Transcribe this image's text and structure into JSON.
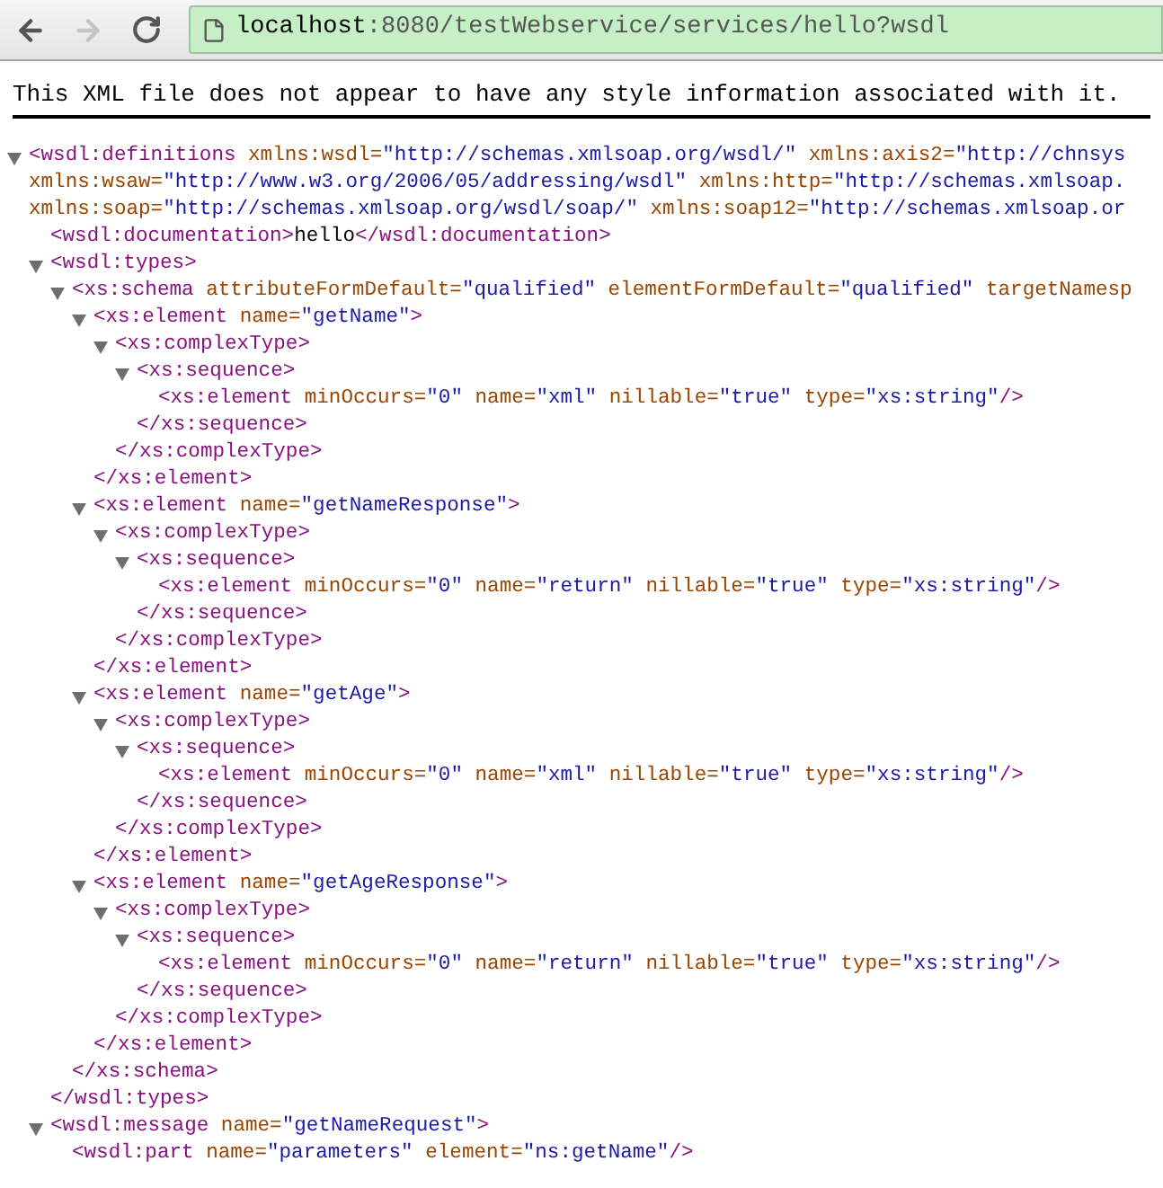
{
  "toolbar": {
    "back": {
      "disabled": false
    },
    "forward": {
      "disabled": true
    },
    "address": {
      "host": "localhost",
      "path": ":8080/testWebservice/services/hello?wsdl"
    }
  },
  "notice": "This XML file does not appear to have any style information associated with it.",
  "tree": [
    {
      "expanded": true,
      "lines": [
        [
          {
            "kind": "tag",
            "text": "<wsdl:definitions"
          },
          {
            "kind": "attr",
            "text": " xmlns:wsdl="
          },
          {
            "kind": "value",
            "text": "\"http://schemas.xmlsoap.org/wsdl/\""
          },
          {
            "kind": "attr",
            "text": " xmlns:axis2="
          },
          {
            "kind": "value",
            "text": "\"http://chnsys"
          }
        ],
        [
          {
            "kind": "attr",
            "text": "xmlns:wsaw="
          },
          {
            "kind": "value",
            "text": "\"http://www.w3.org/2006/05/addressing/wsdl\""
          },
          {
            "kind": "attr",
            "text": " xmlns:http="
          },
          {
            "kind": "value",
            "text": "\"http://schemas.xmlsoap."
          }
        ],
        [
          {
            "kind": "attr",
            "text": "xmlns:soap="
          },
          {
            "kind": "value",
            "text": "\"http://schemas.xmlsoap.org/wsdl/soap/\""
          },
          {
            "kind": "attr",
            "text": " xmlns:soap12="
          },
          {
            "kind": "value",
            "text": "\"http://schemas.xmlsoap.or"
          }
        ]
      ],
      "children": [
        {
          "lines": [
            [
              {
                "kind": "tag",
                "text": "<wsdl:documentation>"
              },
              {
                "kind": "text",
                "text": "hello"
              },
              {
                "kind": "tag",
                "text": "</wsdl:documentation>"
              }
            ]
          ]
        },
        {
          "expanded": true,
          "lines": [
            [
              {
                "kind": "tag",
                "text": "<wsdl:types>"
              }
            ]
          ],
          "close": "</wsdl:types>",
          "children": [
            {
              "expanded": true,
              "lines": [
                [
                  {
                    "kind": "tag",
                    "text": "<xs:schema"
                  },
                  {
                    "kind": "attr",
                    "text": " attributeFormDefault="
                  },
                  {
                    "kind": "value",
                    "text": "\"qualified\""
                  },
                  {
                    "kind": "attr",
                    "text": " elementFormDefault="
                  },
                  {
                    "kind": "value",
                    "text": "\"qualified\""
                  },
                  {
                    "kind": "attr",
                    "text": " targetNamesp"
                  }
                ]
              ],
              "close": "</xs:schema>",
              "children": [
                {
                  "expanded": true,
                  "lines": [
                    [
                      {
                        "kind": "tag",
                        "text": "<xs:element"
                      },
                      {
                        "kind": "attr",
                        "text": " name="
                      },
                      {
                        "kind": "value",
                        "text": "\"getName\""
                      },
                      {
                        "kind": "tag",
                        "text": ">"
                      }
                    ]
                  ],
                  "close": "</xs:element>",
                  "children": [
                    {
                      "expanded": true,
                      "lines": [
                        [
                          {
                            "kind": "tag",
                            "text": "<xs:complexType>"
                          }
                        ]
                      ],
                      "close": "</xs:complexType>",
                      "children": [
                        {
                          "expanded": true,
                          "lines": [
                            [
                              {
                                "kind": "tag",
                                "text": "<xs:sequence>"
                              }
                            ]
                          ],
                          "close": "</xs:sequence>",
                          "children": [
                            {
                              "lines": [
                                [
                                  {
                                    "kind": "tag",
                                    "text": "<xs:element"
                                  },
                                  {
                                    "kind": "attr",
                                    "text": " minOccurs="
                                  },
                                  {
                                    "kind": "value",
                                    "text": "\"0\""
                                  },
                                  {
                                    "kind": "attr",
                                    "text": " name="
                                  },
                                  {
                                    "kind": "value",
                                    "text": "\"xml\""
                                  },
                                  {
                                    "kind": "attr",
                                    "text": " nillable="
                                  },
                                  {
                                    "kind": "value",
                                    "text": "\"true\""
                                  },
                                  {
                                    "kind": "attr",
                                    "text": " type="
                                  },
                                  {
                                    "kind": "value",
                                    "text": "\"xs:string\""
                                  },
                                  {
                                    "kind": "tag",
                                    "text": "/>"
                                  }
                                ]
                              ]
                            }
                          ]
                        }
                      ]
                    }
                  ]
                },
                {
                  "expanded": true,
                  "lines": [
                    [
                      {
                        "kind": "tag",
                        "text": "<xs:element"
                      },
                      {
                        "kind": "attr",
                        "text": " name="
                      },
                      {
                        "kind": "value",
                        "text": "\"getNameResponse\""
                      },
                      {
                        "kind": "tag",
                        "text": ">"
                      }
                    ]
                  ],
                  "close": "</xs:element>",
                  "children": [
                    {
                      "expanded": true,
                      "lines": [
                        [
                          {
                            "kind": "tag",
                            "text": "<xs:complexType>"
                          }
                        ]
                      ],
                      "close": "</xs:complexType>",
                      "children": [
                        {
                          "expanded": true,
                          "lines": [
                            [
                              {
                                "kind": "tag",
                                "text": "<xs:sequence>"
                              }
                            ]
                          ],
                          "close": "</xs:sequence>",
                          "children": [
                            {
                              "lines": [
                                [
                                  {
                                    "kind": "tag",
                                    "text": "<xs:element"
                                  },
                                  {
                                    "kind": "attr",
                                    "text": " minOccurs="
                                  },
                                  {
                                    "kind": "value",
                                    "text": "\"0\""
                                  },
                                  {
                                    "kind": "attr",
                                    "text": " name="
                                  },
                                  {
                                    "kind": "value",
                                    "text": "\"return\""
                                  },
                                  {
                                    "kind": "attr",
                                    "text": " nillable="
                                  },
                                  {
                                    "kind": "value",
                                    "text": "\"true\""
                                  },
                                  {
                                    "kind": "attr",
                                    "text": " type="
                                  },
                                  {
                                    "kind": "value",
                                    "text": "\"xs:string\""
                                  },
                                  {
                                    "kind": "tag",
                                    "text": "/>"
                                  }
                                ]
                              ]
                            }
                          ]
                        }
                      ]
                    }
                  ]
                },
                {
                  "expanded": true,
                  "lines": [
                    [
                      {
                        "kind": "tag",
                        "text": "<xs:element"
                      },
                      {
                        "kind": "attr",
                        "text": " name="
                      },
                      {
                        "kind": "value",
                        "text": "\"getAge\""
                      },
                      {
                        "kind": "tag",
                        "text": ">"
                      }
                    ]
                  ],
                  "close": "</xs:element>",
                  "children": [
                    {
                      "expanded": true,
                      "lines": [
                        [
                          {
                            "kind": "tag",
                            "text": "<xs:complexType>"
                          }
                        ]
                      ],
                      "close": "</xs:complexType>",
                      "children": [
                        {
                          "expanded": true,
                          "lines": [
                            [
                              {
                                "kind": "tag",
                                "text": "<xs:sequence>"
                              }
                            ]
                          ],
                          "close": "</xs:sequence>",
                          "children": [
                            {
                              "lines": [
                                [
                                  {
                                    "kind": "tag",
                                    "text": "<xs:element"
                                  },
                                  {
                                    "kind": "attr",
                                    "text": " minOccurs="
                                  },
                                  {
                                    "kind": "value",
                                    "text": "\"0\""
                                  },
                                  {
                                    "kind": "attr",
                                    "text": " name="
                                  },
                                  {
                                    "kind": "value",
                                    "text": "\"xml\""
                                  },
                                  {
                                    "kind": "attr",
                                    "text": " nillable="
                                  },
                                  {
                                    "kind": "value",
                                    "text": "\"true\""
                                  },
                                  {
                                    "kind": "attr",
                                    "text": " type="
                                  },
                                  {
                                    "kind": "value",
                                    "text": "\"xs:string\""
                                  },
                                  {
                                    "kind": "tag",
                                    "text": "/>"
                                  }
                                ]
                              ]
                            }
                          ]
                        }
                      ]
                    }
                  ]
                },
                {
                  "expanded": true,
                  "lines": [
                    [
                      {
                        "kind": "tag",
                        "text": "<xs:element"
                      },
                      {
                        "kind": "attr",
                        "text": " name="
                      },
                      {
                        "kind": "value",
                        "text": "\"getAgeResponse\""
                      },
                      {
                        "kind": "tag",
                        "text": ">"
                      }
                    ]
                  ],
                  "close": "</xs:element>",
                  "children": [
                    {
                      "expanded": true,
                      "lines": [
                        [
                          {
                            "kind": "tag",
                            "text": "<xs:complexType>"
                          }
                        ]
                      ],
                      "close": "</xs:complexType>",
                      "children": [
                        {
                          "expanded": true,
                          "lines": [
                            [
                              {
                                "kind": "tag",
                                "text": "<xs:sequence>"
                              }
                            ]
                          ],
                          "close": "</xs:sequence>",
                          "children": [
                            {
                              "lines": [
                                [
                                  {
                                    "kind": "tag",
                                    "text": "<xs:element"
                                  },
                                  {
                                    "kind": "attr",
                                    "text": " minOccurs="
                                  },
                                  {
                                    "kind": "value",
                                    "text": "\"0\""
                                  },
                                  {
                                    "kind": "attr",
                                    "text": " name="
                                  },
                                  {
                                    "kind": "value",
                                    "text": "\"return\""
                                  },
                                  {
                                    "kind": "attr",
                                    "text": " nillable="
                                  },
                                  {
                                    "kind": "value",
                                    "text": "\"true\""
                                  },
                                  {
                                    "kind": "attr",
                                    "text": " type="
                                  },
                                  {
                                    "kind": "value",
                                    "text": "\"xs:string\""
                                  },
                                  {
                                    "kind": "tag",
                                    "text": "/>"
                                  }
                                ]
                              ]
                            }
                          ]
                        }
                      ]
                    }
                  ]
                }
              ]
            }
          ]
        },
        {
          "expanded": true,
          "lines": [
            [
              {
                "kind": "tag",
                "text": "<wsdl:message"
              },
              {
                "kind": "attr",
                "text": " name="
              },
              {
                "kind": "value",
                "text": "\"getNameRequest\""
              },
              {
                "kind": "tag",
                "text": ">"
              }
            ]
          ],
          "children": [
            {
              "lines": [
                [
                  {
                    "kind": "tag",
                    "text": "<wsdl:part"
                  },
                  {
                    "kind": "attr",
                    "text": " name="
                  },
                  {
                    "kind": "value",
                    "text": "\"parameters\""
                  },
                  {
                    "kind": "attr",
                    "text": " element="
                  },
                  {
                    "kind": "value",
                    "text": "\"ns:getName\""
                  },
                  {
                    "kind": "tag",
                    "text": "/>"
                  }
                ]
              ]
            }
          ]
        }
      ]
    }
  ]
}
